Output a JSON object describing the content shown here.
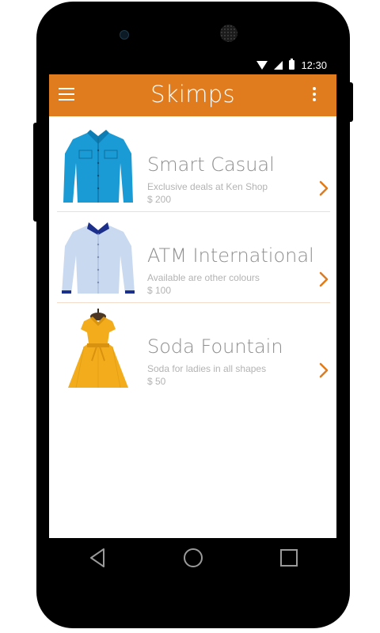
{
  "status": {
    "time": "12:30"
  },
  "appbar": {
    "title": "Skimps"
  },
  "items": [
    {
      "title": "Smart Casual",
      "subtitle": "Exclusive deals at Ken Shop",
      "price": "$ 200"
    },
    {
      "title": "ATM International",
      "subtitle": "Available are other colours",
      "price": "$ 100"
    },
    {
      "title": "Soda Fountain",
      "subtitle": "Soda for ladies in all shapes",
      "price": "$ 50"
    }
  ],
  "colors": {
    "accent": "#e07b1e",
    "divider": "#f4dccb",
    "text": "#8e8e8e",
    "subtext": "#b3b3b3"
  },
  "icons": {
    "menu": "hamburger-icon",
    "overflow": "more-vert-icon",
    "chevron": "chevron-right-icon",
    "back": "back-icon",
    "home": "home-icon",
    "recents": "recents-icon"
  }
}
